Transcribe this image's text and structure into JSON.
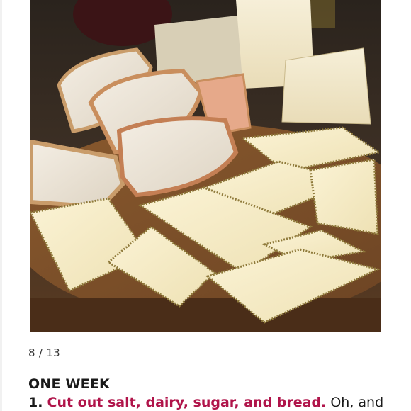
{
  "slideshow": {
    "photo": {
      "alt": "Sliced cheese and rustic bread on a wooden board"
    },
    "counter": "8 / 13",
    "section_heading": "ONE WEEK",
    "tip": {
      "number": "1.",
      "highlight": "Cut out salt, dairy, sugar, and bread.",
      "rest": " Oh, and"
    }
  },
  "colors": {
    "highlight": "#b0144a",
    "text": "#1a1a1a"
  },
  "icons": []
}
